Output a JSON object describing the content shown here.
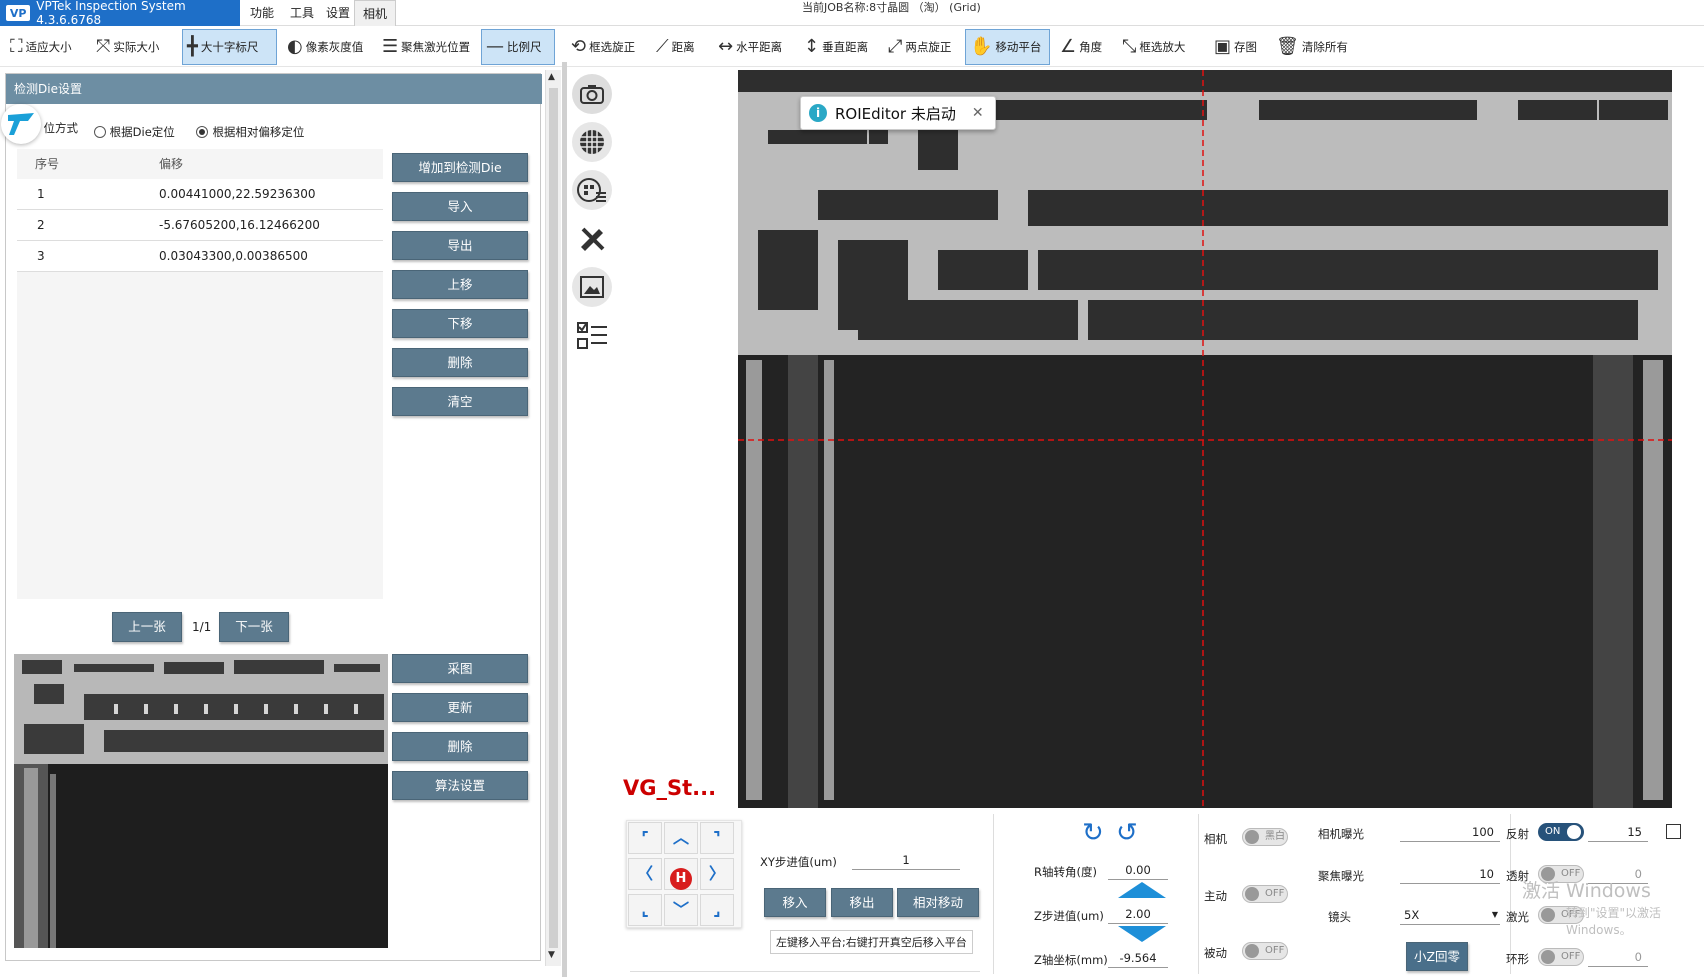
{
  "app": {
    "title": "VPTek Inspection System 4.3.6.6768",
    "logo": "VP"
  },
  "menu": [
    "功能",
    "工具",
    "设置",
    "相机"
  ],
  "job": {
    "label": "当前JOB名称:",
    "name": "8寸晶圆 （淘） (Grid)"
  },
  "toolbar": [
    {
      "label": "适应大小",
      "icon": "⛶"
    },
    {
      "label": "实际大小",
      "icon": "⤧"
    },
    {
      "label": "大十字标尺",
      "icon": "╋"
    },
    {
      "label": "像素灰度值",
      "icon": "◐"
    },
    {
      "label": "聚焦激光位置",
      "icon": "☰"
    },
    {
      "label": "比例尺",
      "icon": "—"
    },
    {
      "label": "框选旋正",
      "icon": "⟲"
    },
    {
      "label": "距离",
      "icon": "⟋"
    },
    {
      "label": "水平距离",
      "icon": "↔"
    },
    {
      "label": "垂直距离",
      "icon": "↕"
    },
    {
      "label": "两点旋正",
      "icon": "⤢"
    },
    {
      "label": "移动平台",
      "icon": "✋"
    },
    {
      "label": "角度",
      "icon": "∠"
    },
    {
      "label": "框选放大",
      "icon": "⤡"
    },
    {
      "label": "存图",
      "icon": "▣"
    },
    {
      "label": "清除所有",
      "icon": "🗑"
    }
  ],
  "left": {
    "title": "检测Die设置",
    "locate_label": "定位方式",
    "radio1": "根据Die定位",
    "radio2": "根据相对偏移定位",
    "col_index": "序号",
    "col_offset": "偏移",
    "rows": [
      {
        "index": "1",
        "offset": "0.00441000,22.59236300"
      },
      {
        "index": "2",
        "offset": "-5.67605200,16.12466200"
      },
      {
        "index": "3",
        "offset": "0.03043300,0.00386500"
      }
    ],
    "buttons": [
      "增加到检测Die",
      "导入",
      "导出",
      "上移",
      "下移",
      "删除",
      "清空"
    ],
    "prev": "上一张",
    "page": "1/1",
    "next": "下一张",
    "img_buttons": [
      "采图",
      "更新",
      "删除",
      "算法设置"
    ]
  },
  "roi_tip": {
    "text": "ROIEditor 未启动"
  },
  "vg_text": "VG_St...",
  "bottom": {
    "xy_step_label": "XY步进值(um)",
    "xy_step": "1",
    "move_in": "移入",
    "move_out": "移出",
    "rel_move": "相对移动",
    "hint": "左键移入平台;右键打开真空后移入平台",
    "r_label": "R轴转角(度)",
    "r_val": "0.00",
    "z_step_label": "Z步进值(um)",
    "z_step": "2.00",
    "z_coord_label": "Z轴坐标(mm)",
    "z_coord": "-9.564",
    "cam_label": "相机",
    "cam_toggle": "黑白",
    "active_label": "主动",
    "active_toggle": "OFF",
    "passive_label": "被动",
    "passive_toggle": "OFF",
    "cam_exp_label": "相机曝光",
    "cam_exp": "100",
    "focus_exp_label": "聚焦曝光",
    "focus_exp": "10",
    "lens_label": "镜头",
    "lens": "5X",
    "home_btn": "小Z回零",
    "reflect_label": "反射",
    "reflect_toggle": "ON",
    "reflect_val": "15",
    "trans_label": "透射",
    "trans_toggle": "OFF",
    "trans_val": "0",
    "laser_label": "激光",
    "laser_toggle": "OFF",
    "ring_label": "环形",
    "ring_toggle": "OFF",
    "ring_val": "0",
    "home_key": "H"
  },
  "watermark": {
    "line1": "激活 Windows",
    "line2": "转到\"设置\"以激活 Windows。"
  }
}
